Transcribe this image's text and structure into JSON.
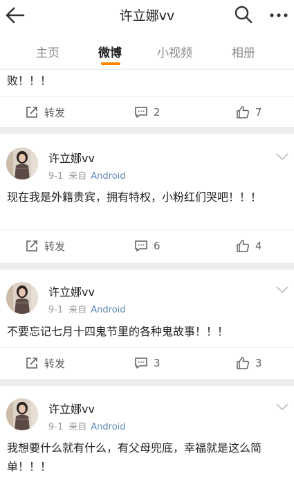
{
  "header": {
    "title": "许立娜vv",
    "back_icon": "back-arrow-icon",
    "search_icon": "search-icon",
    "more_icon": "more-dots-icon"
  },
  "tabs": [
    {
      "label": "主页",
      "active": false
    },
    {
      "label": "微博",
      "active": true
    },
    {
      "label": "小视频",
      "active": false
    },
    {
      "label": "相册",
      "active": false
    }
  ],
  "accent_color": "#ff8200",
  "link_color": "#5b86b3",
  "top_fragment": {
    "text": "败！！！",
    "repost_label": "转发",
    "comments": "2",
    "likes": "7"
  },
  "posts": [
    {
      "author": "许立娜vv",
      "date": "9-1",
      "from_label": "来自",
      "source": "Android",
      "text": "现在我是外籍贵宾，拥有特权，小粉红们哭吧！！！",
      "repost_label": "转发",
      "comments": "6",
      "likes": "4"
    },
    {
      "author": "许立娜vv",
      "date": "9-1",
      "from_label": "来自",
      "source": "Android",
      "text": "不要忘记七月十四鬼节里的各种鬼故事！！！",
      "repost_label": "转发",
      "comments": "3",
      "likes": "3"
    },
    {
      "author": "许立娜vv",
      "date": "9-1",
      "from_label": "来自",
      "source": "Android",
      "text": "我想要什么就有什么，有父母兜底，幸福就是这么简单！！！"
    }
  ]
}
